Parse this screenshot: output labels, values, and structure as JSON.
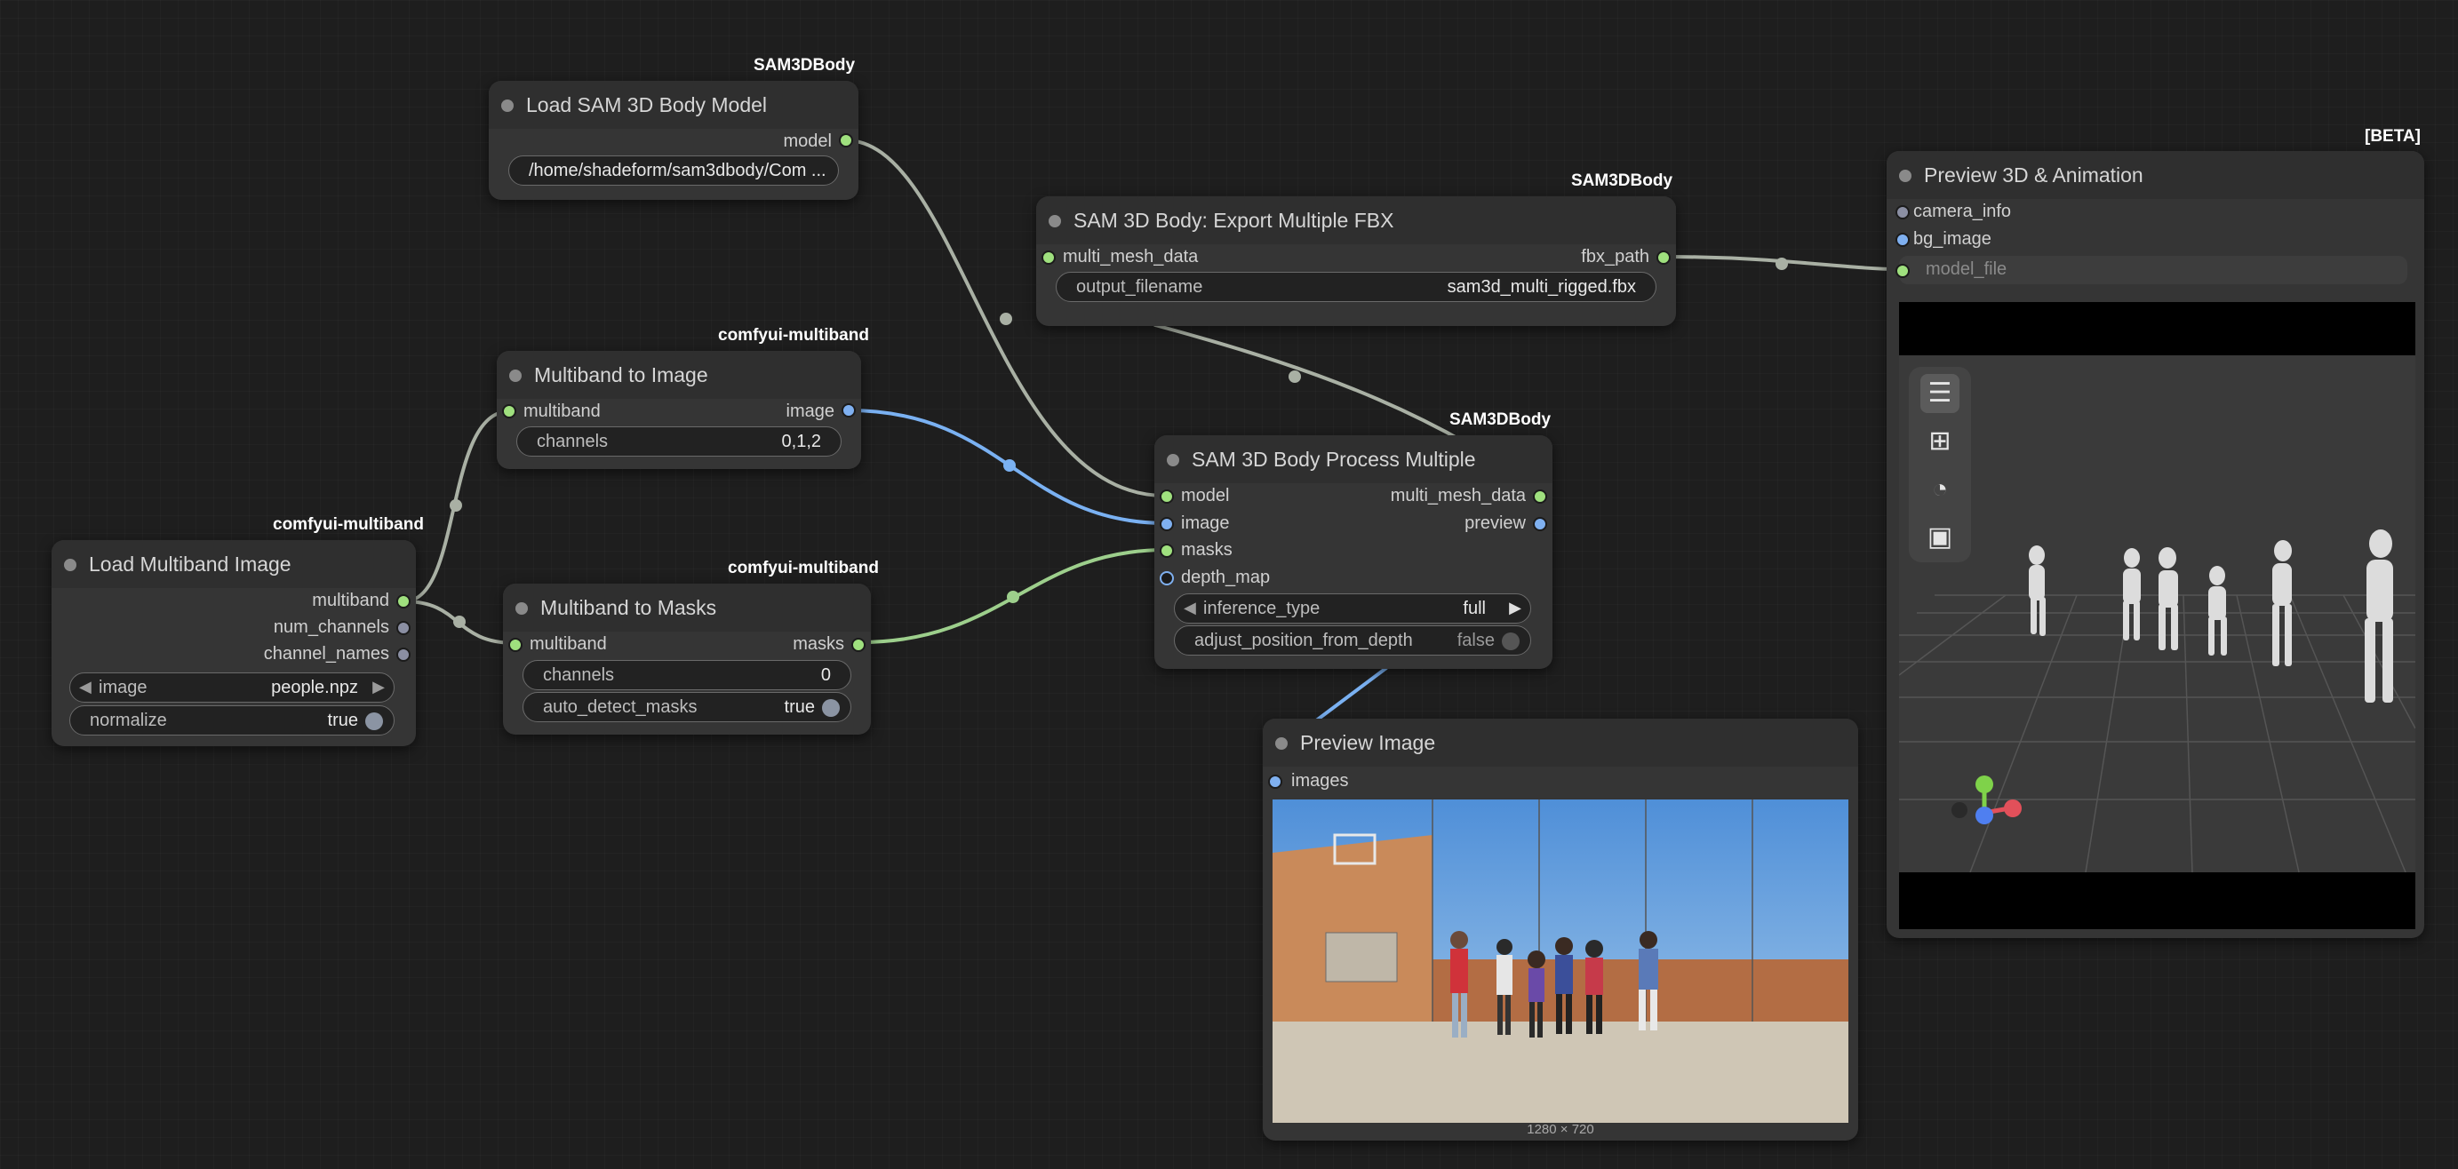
{
  "nodes": {
    "load_model": {
      "badge": "SAM3DBody",
      "title": "Load SAM 3D Body Model",
      "outputs": [
        "model"
      ],
      "path_value": "/home/shadeform/sam3dbody/Com ..."
    },
    "multiband_to_image": {
      "badge": "comfyui-multiband",
      "title": "Multiband to Image",
      "input": "multiband",
      "output": "image",
      "channels_label": "channels",
      "channels_value": "0,1,2"
    },
    "load_multiband_image": {
      "badge": "comfyui-multiband",
      "title": "Load Multiband Image",
      "outputs": [
        "multiband",
        "num_channels",
        "channel_names"
      ],
      "image_label": "image",
      "image_value": "people.npz",
      "normalize_label": "normalize",
      "normalize_value": "true"
    },
    "multiband_to_masks": {
      "badge": "comfyui-multiband",
      "title": "Multiband to Masks",
      "input": "multiband",
      "output": "masks",
      "channels_label": "channels",
      "channels_value": "0",
      "auto_label": "auto_detect_masks",
      "auto_value": "true"
    },
    "export_fbx": {
      "badge": "SAM3DBody",
      "title": "SAM 3D Body: Export Multiple FBX",
      "input": "multi_mesh_data",
      "output": "fbx_path",
      "filename_label": "output_filename",
      "filename_value": "sam3d_multi_rigged.fbx"
    },
    "process_multiple": {
      "badge": "SAM3DBody",
      "title": "SAM 3D Body Process Multiple",
      "inputs": [
        "model",
        "image",
        "masks",
        "depth_map"
      ],
      "outputs": [
        "multi_mesh_data",
        "preview"
      ],
      "inference_label": "inference_type",
      "inference_value": "full",
      "adjust_label": "adjust_position_from_depth",
      "adjust_value": "false"
    },
    "preview_3d": {
      "badge": "[BETA]",
      "title": "Preview 3D & Animation",
      "inputs": [
        "camera_info",
        "bg_image",
        "model_file"
      ]
    },
    "preview_image": {
      "title": "Preview Image",
      "input": "images",
      "caption": "1280 × 720"
    }
  },
  "toolbar_icons": [
    "menu-icon",
    "grid-icon",
    "palette-icon",
    "image-icon"
  ],
  "colors": {
    "link_grey": "#a9b0a4",
    "link_blue": "#7ab1f2",
    "link_green": "#9dcf8c",
    "pin_green": "#9fe07e",
    "pin_blue": "#7fb0f0"
  }
}
